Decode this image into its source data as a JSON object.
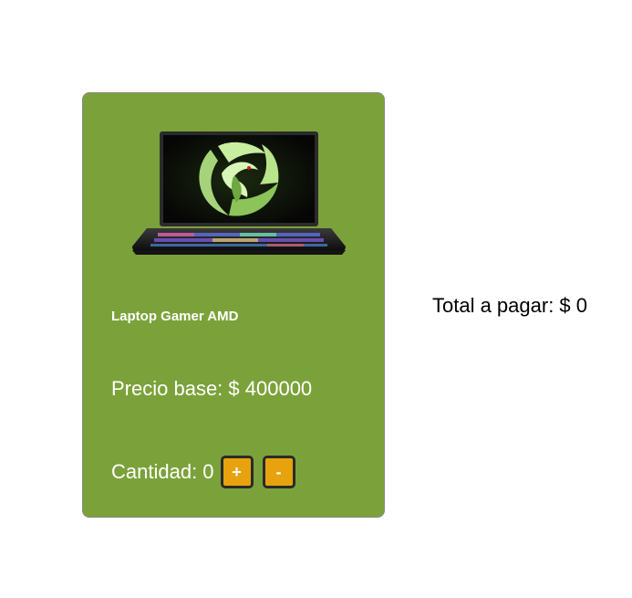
{
  "product": {
    "name": "Laptop Gamer AMD",
    "price_text": "Precio base: $ 400000",
    "quantity_text": "Cantidad: 0",
    "image_icon": "laptop-image"
  },
  "controls": {
    "plus_label": "+",
    "minus_label": "-"
  },
  "summary": {
    "total_text": "Total a pagar: $ 0"
  },
  "colors": {
    "card_background": "#7ba23a",
    "button_background": "#e8a20d",
    "button_border": "#2a2a2a"
  }
}
